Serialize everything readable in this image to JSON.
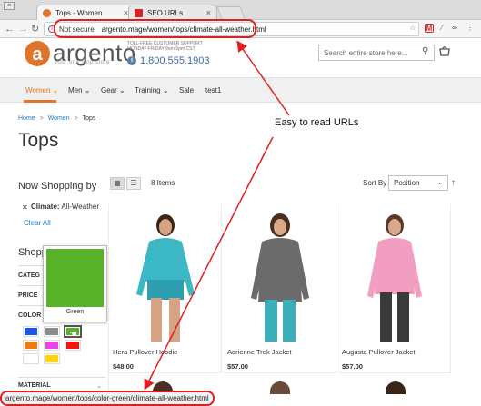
{
  "browser": {
    "tabs": [
      {
        "title": "Tops - Women",
        "close": "×",
        "active": true
      },
      {
        "title": "SEO URLs",
        "close": "×",
        "active": false
      }
    ],
    "security_label": "Not secure",
    "url": "argento.mage/women/tops/climate-all-weather.html",
    "status_url": "argento.mage/women/tops/color-green/climate-all-weather.html",
    "icons": [
      "back-icon",
      "forward-icon",
      "reload-icon",
      "info-icon",
      "star-icon",
      "gmail-icon",
      "extension-icon",
      "glasses-icon",
      "menu-icon"
    ]
  },
  "header": {
    "logo_text": "argento",
    "tagline": "your one stop store",
    "support_line1": "TOLL-FREE CUSTOMER SUPPORT",
    "support_line2": "MONDAY-FRIDAY 9am-5pm CST",
    "phone": "1.800.555.1903",
    "search_placeholder": "Search entire store here...",
    "brand_color": "#e0742a"
  },
  "nav": {
    "items": [
      {
        "label": "Women ⌄",
        "active": true
      },
      {
        "label": "Men ⌄",
        "active": false
      },
      {
        "label": "Gear ⌄",
        "active": false
      },
      {
        "label": "Training ⌄",
        "active": false
      },
      {
        "label": "Sale",
        "active": false
      },
      {
        "label": "test1",
        "active": false
      }
    ]
  },
  "breadcrumb": {
    "home": "Home",
    "women": "Women",
    "current": "Tops",
    "separator": ">"
  },
  "page_title": "Tops",
  "annotation": "Easy to read URLs",
  "sidebar": {
    "now_shopping": "Now Shopping by",
    "active_filter_name": "Climate:",
    "active_filter_value": "All-Weather",
    "clear_all": "Clear All",
    "shopping_options": "Shopp",
    "rows": [
      "CATEG",
      "PRICE",
      "COLOR"
    ],
    "material": "MATERIAL",
    "tooltip_label": "Green",
    "swatches": [
      "#1a56e8",
      "#8c8c8c",
      "#57b22a",
      "#ee7a12",
      "#e845e8",
      "#ff1010",
      "#ffffff",
      "#ffd400"
    ]
  },
  "toolbar": {
    "items_count": "8 Items",
    "sort_label": "Sort By",
    "sort_value": "Position",
    "sort_chevron": "⌄",
    "sort_dir": "↑"
  },
  "products": [
    {
      "name": "Hera Pullover Hoodie",
      "price": "$48.00"
    },
    {
      "name": "Adrienne Trek Jacket",
      "price": "$57.00"
    },
    {
      "name": "Augusta Pullover Jacket",
      "price": "$57.00"
    }
  ]
}
